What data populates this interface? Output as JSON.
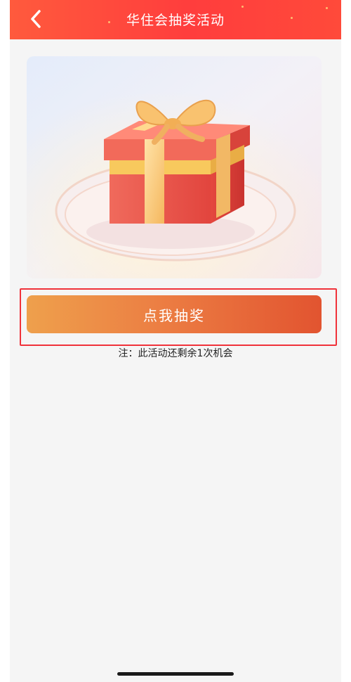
{
  "header": {
    "title": "华住会抽奖活动",
    "back_icon": "chevron-left-icon",
    "background_color": "#ff4a3a"
  },
  "hero": {
    "image": "gift-box-illustration"
  },
  "action": {
    "draw_label": "点我抽奖",
    "button_colors": [
      "#eea04c",
      "#e25430"
    ]
  },
  "note": {
    "text": "注：此活动还剩余1次机会"
  }
}
